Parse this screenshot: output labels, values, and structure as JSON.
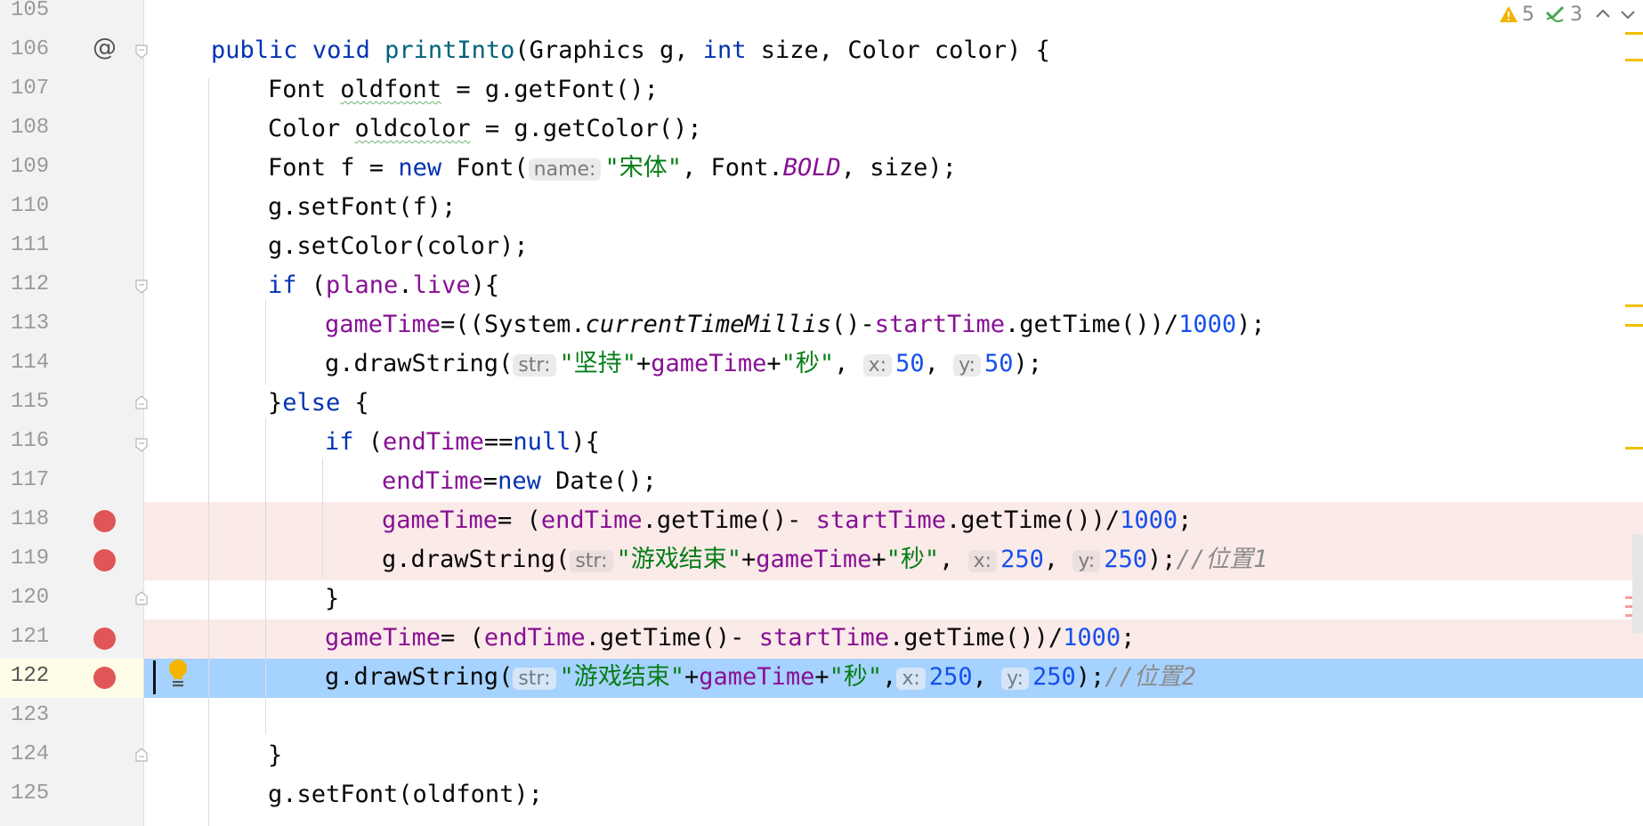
{
  "inspections": {
    "warnings_count": "5",
    "weak_warnings_count": "3",
    "warning_icon": "warning-triangle-icon",
    "weak_warning_icon": "double-check-icon",
    "colors": {
      "warning": "#f0b400",
      "weak": "#4aa54a",
      "breakpoint": "#e05555",
      "selection": "#a6d2ff"
    }
  },
  "lines": [
    {
      "no": "105"
    },
    {
      "no": "106",
      "t106_1": "public",
      "t106_2": "void",
      "t106_3": "printInto",
      "t106_4": "(Graphics g, ",
      "t106_5": "int",
      "t106_6": " size, Color color) {"
    },
    {
      "no": "107",
      "t107_1": "Font ",
      "t107_2": "oldfont",
      "t107_3": " = g.getFont();"
    },
    {
      "no": "108",
      "t108_1": "Color ",
      "t108_2": "oldcolor",
      "t108_3": " = g.getColor();"
    },
    {
      "no": "109",
      "t109_1": "Font f = ",
      "t109_2": "new",
      "t109_3": " Font(",
      "h109": "name:",
      "t109_4": "\"宋体\"",
      "t109_5": ", Font.",
      "t109_6": "BOLD",
      "t109_7": ", size);"
    },
    {
      "no": "110",
      "t110": "g.setFont(f);"
    },
    {
      "no": "111",
      "t111": "g.setColor(color);"
    },
    {
      "no": "112",
      "t112_1": "if",
      "t112_2": " (",
      "t112_3": "plane",
      "t112_4": ".",
      "t112_5": "live",
      "t112_6": "){"
    },
    {
      "no": "113",
      "t113_1": "gameTime",
      "t113_2": "=((System.",
      "t113_3": "currentTimeMillis",
      "t113_4": "()-",
      "t113_5": "startTime",
      "t113_6": ".getTime())/",
      "t113_7": "1000",
      "t113_8": ");"
    },
    {
      "no": "114",
      "t114_1": "g.drawString(",
      "h114a": "str:",
      "t114_2": "\"坚持\"",
      "t114_3": "+",
      "t114_4": "gameTime",
      "t114_5": "+",
      "t114_6": "\"秒\"",
      "t114_7": ", ",
      "h114b": "x:",
      "t114_8": "50",
      "t114_9": ", ",
      "h114c": "y:",
      "t114_10": "50",
      "t114_11": ");"
    },
    {
      "no": "115",
      "t115_1": "}",
      "t115_2": "else",
      "t115_3": " {"
    },
    {
      "no": "116",
      "t116_1": "if",
      "t116_2": " (",
      "t116_3": "endTime",
      "t116_4": "==",
      "t116_5": "null",
      "t116_6": "){"
    },
    {
      "no": "117",
      "t117_1": "endTime",
      "t117_2": "=",
      "t117_3": "new",
      "t117_4": " Date();"
    },
    {
      "no": "118",
      "t118_1": "gameTime",
      "t118_2": "= (",
      "t118_3": "endTime",
      "t118_4": ".getTime()- ",
      "t118_5": "startTime",
      "t118_6": ".getTime())/",
      "t118_7": "1000",
      "t118_8": ";"
    },
    {
      "no": "119",
      "t119_1": "g.drawString(",
      "h119a": "str:",
      "t119_2": "\"游戏结束\"",
      "t119_3": "+",
      "t119_4": "gameTime",
      "t119_5": "+",
      "t119_6": "\"秒\"",
      "t119_7": ", ",
      "h119b": "x:",
      "t119_8": "250",
      "t119_9": ", ",
      "h119c": "y:",
      "t119_10": "250",
      "t119_11": ");",
      "t119_12": "//位置1"
    },
    {
      "no": "120",
      "t120": "}"
    },
    {
      "no": "121",
      "t121_1": "gameTime",
      "t121_2": "= (",
      "t121_3": "endTime",
      "t121_4": ".getTime()- ",
      "t121_5": "startTime",
      "t121_6": ".getTime())/",
      "t121_7": "1000",
      "t121_8": ";"
    },
    {
      "no": "122",
      "t122_1": "g.drawString(",
      "h122a": "str:",
      "t122_2": "\"游戏结束\"",
      "t122_3": "+",
      "t122_4": "gameTime",
      "t122_5": "+",
      "t122_6": "\"秒\"",
      "t122_7": ",",
      "h122b": "x:",
      "t122_8": "250",
      "t122_9": ", ",
      "h122c": "y:",
      "t122_10": "250",
      "t122_11": ");",
      "t122_12": "//位置2"
    },
    {
      "no": "123"
    },
    {
      "no": "124",
      "t124": "}"
    },
    {
      "no": "125",
      "t125": "g.setFont(oldfont);"
    }
  ]
}
